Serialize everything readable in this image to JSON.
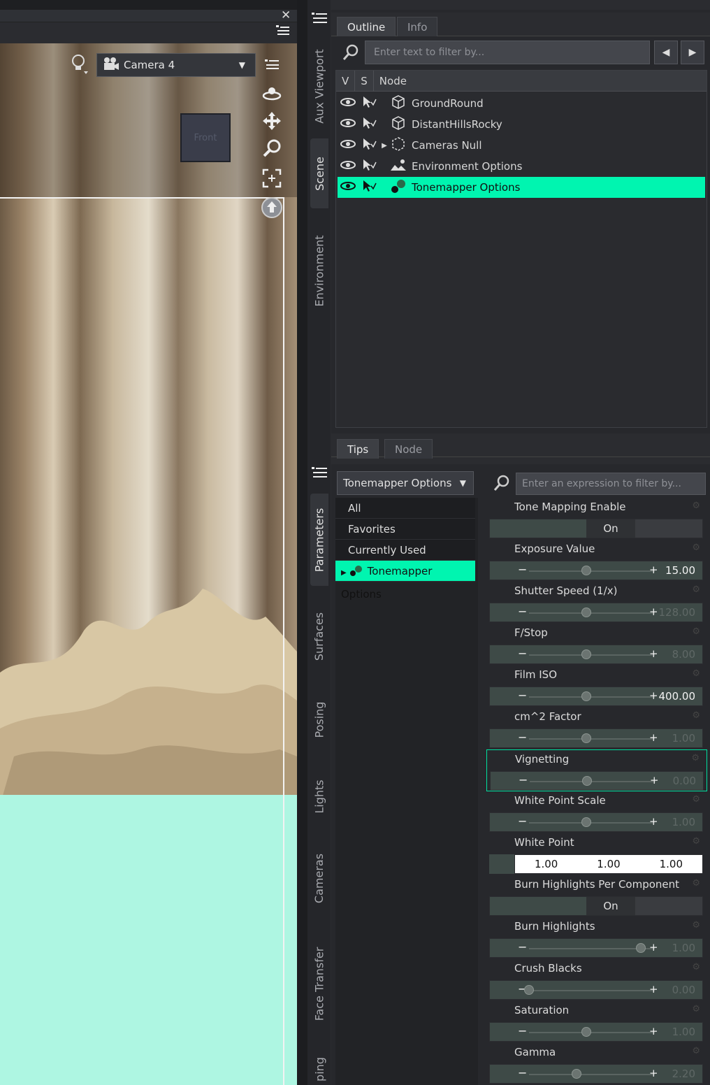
{
  "viewport": {
    "close_glyph": "✕",
    "camera_label": "Camera 4",
    "nav_cube_label": "Front"
  },
  "side_tabs_top": [
    "Aux Viewport",
    "Scene",
    "Environment"
  ],
  "side_tabs_bottom": [
    "Parameters",
    "Surfaces",
    "Posing",
    "Lights",
    "Cameras",
    "Face Transfer",
    "ping"
  ],
  "scene": {
    "tabs": [
      "Outline",
      "Info"
    ],
    "filter_placeholder": "Enter text to filter by...",
    "columns": [
      "V",
      "S",
      "Node"
    ],
    "nodes": [
      {
        "label": "GroundRound",
        "icon": "cube-icon",
        "selected": false,
        "expandable": false
      },
      {
        "label": "DistantHillsRocky",
        "icon": "cube-icon",
        "selected": false,
        "expandable": false
      },
      {
        "label": "Cameras Null",
        "icon": "null-icon",
        "selected": false,
        "expandable": true
      },
      {
        "label": "Environment Options",
        "icon": "environment-icon",
        "selected": false,
        "expandable": false
      },
      {
        "label": "Tonemapper Options",
        "icon": "tonemapper-icon",
        "selected": true,
        "expandable": false
      }
    ],
    "bottom_tabs": [
      "Tips",
      "Node"
    ]
  },
  "parameters": {
    "group_select": "Tonemapper Options",
    "filter_placeholder": "Enter an expression to filter by...",
    "groups": [
      "All",
      "Favorites",
      "Currently Used",
      "Tonemapper Options"
    ],
    "properties": [
      {
        "name": "Tone Mapping Enable",
        "kind": "toggle",
        "value": "On"
      },
      {
        "name": "Exposure Value",
        "kind": "slider",
        "value": "15.00",
        "pos": 0.48,
        "bright": true
      },
      {
        "name": "Shutter Speed (1/x)",
        "kind": "slider",
        "value": "128.00",
        "pos": 0.48,
        "bright": false
      },
      {
        "name": "F/Stop",
        "kind": "slider",
        "value": "8.00",
        "pos": 0.48,
        "bright": false
      },
      {
        "name": "Film ISO",
        "kind": "slider",
        "value": "400.00",
        "pos": 0.48,
        "bright": true
      },
      {
        "name": "cm^2 Factor",
        "kind": "slider",
        "value": "1.00",
        "pos": 0.48,
        "bright": false
      },
      {
        "name": "Vignetting",
        "kind": "slider",
        "value": "0.00",
        "pos": 0.48,
        "bright": false
      },
      {
        "name": "White Point Scale",
        "kind": "slider",
        "value": "1.00",
        "pos": 0.48,
        "bright": false
      },
      {
        "name": "White Point",
        "kind": "color",
        "values": [
          "1.00",
          "1.00",
          "1.00"
        ]
      },
      {
        "name": "Burn Highlights Per Component",
        "kind": "toggle",
        "value": "On"
      },
      {
        "name": "Burn Highlights",
        "kind": "slider",
        "value": "1.00",
        "pos": 0.94,
        "bright": false
      },
      {
        "name": "Crush Blacks",
        "kind": "slider",
        "value": "0.00",
        "pos": 0.0,
        "bright": false
      },
      {
        "name": "Saturation",
        "kind": "slider",
        "value": "1.00",
        "pos": 0.48,
        "bright": false
      },
      {
        "name": "Gamma",
        "kind": "slider",
        "value": "2.20",
        "pos": 0.4,
        "bright": false
      }
    ]
  }
}
